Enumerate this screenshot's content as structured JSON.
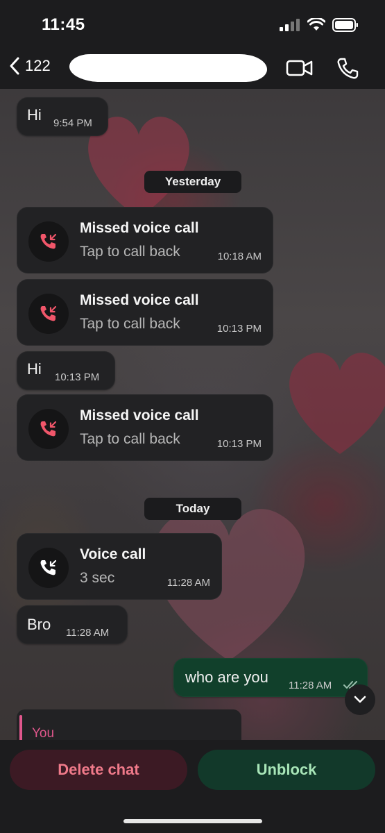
{
  "status_bar": {
    "time": "11:45"
  },
  "header": {
    "back_count": "122"
  },
  "messages": {
    "m1": {
      "text": "Hi",
      "time": "9:54 PM"
    },
    "day1": "Yesterday",
    "call1": {
      "title": "Missed voice call",
      "sub": "Tap to call back",
      "time": "10:18 AM"
    },
    "call2": {
      "title": "Missed voice call",
      "sub": "Tap to call back",
      "time": "10:13 PM"
    },
    "m2": {
      "text": "Hi",
      "time": "10:13 PM"
    },
    "call3": {
      "title": "Missed voice call",
      "sub": "Tap to call back",
      "time": "10:13 PM"
    },
    "day2": "Today",
    "call4": {
      "title": "Voice call",
      "sub": "3 sec",
      "time": "11:28 AM"
    },
    "m3": {
      "text": "Bro",
      "time": "11:28 AM"
    },
    "m4": {
      "text": "who are you",
      "time": "11:28 AM"
    }
  },
  "reply": {
    "label": "You"
  },
  "actions": {
    "delete_label": "Delete chat",
    "unblock_label": "Unblock"
  },
  "colors": {
    "missed_call": "#f0566a",
    "outgoing_bubble": "#11402b",
    "delete_text": "#f07a8a",
    "unblock_text": "#a8e6b8"
  }
}
